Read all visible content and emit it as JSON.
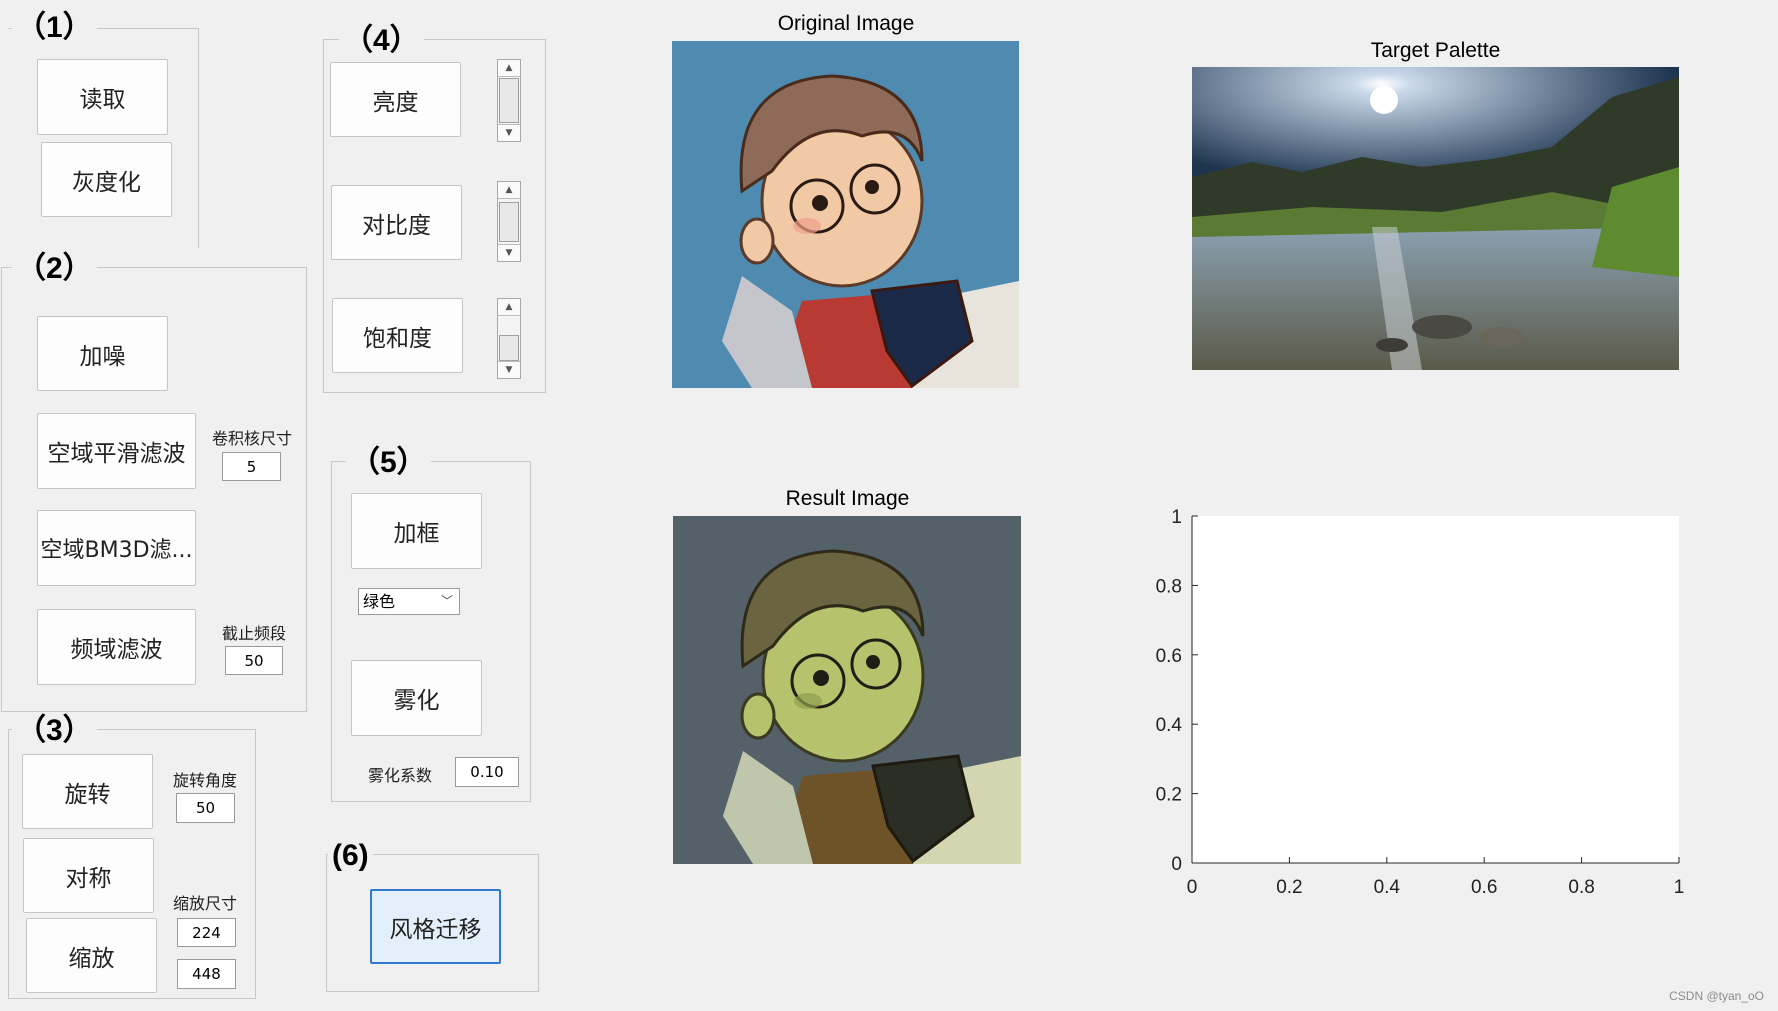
{
  "panel1": {
    "title": "（1）",
    "read_label": "读取",
    "gray_label": "灰度化"
  },
  "panel2": {
    "title": "（2）",
    "noise_label": "加噪",
    "spatial_smooth_label": "空域平滑滤波",
    "kernel_size_label": "卷积核尺寸",
    "kernel_size_value": "5",
    "bm3d_label": "空域BM3D滤...",
    "freq_filter_label": "频域滤波",
    "cutoff_label": "截止频段",
    "cutoff_value": "50"
  },
  "panel3": {
    "title": "（3）",
    "rotate_label": "旋转",
    "rotate_angle_label": "旋转角度",
    "rotate_angle_value": "50",
    "symmetry_label": "对称",
    "scale_label": "缩放",
    "scale_size_label": "缩放尺寸",
    "scale_w_value": "224",
    "scale_h_value": "448"
  },
  "panel4": {
    "title": "（4）",
    "brightness_label": "亮度",
    "contrast_label": "对比度",
    "saturation_label": "饱和度"
  },
  "panel5": {
    "title": "（5）",
    "frame_label": "加框",
    "color_select_value": "绿色",
    "fog_label": "雾化",
    "fog_coef_label": "雾化系数",
    "fog_coef_value": "0.10"
  },
  "panel6": {
    "title": "(6)",
    "style_transfer_label": "风格迁移"
  },
  "images": {
    "original_title": "Original Image",
    "target_title": "Target Palette",
    "result_title": "Result Image"
  },
  "chart_data": {
    "type": "scatter",
    "series": [],
    "xlim": [
      0,
      1
    ],
    "ylim": [
      0,
      1
    ],
    "x_ticks": [
      "0",
      "0.2",
      "0.4",
      "0.6",
      "0.8",
      "1"
    ],
    "y_ticks": [
      "0",
      "0.2",
      "0.4",
      "0.6",
      "0.8",
      "1"
    ],
    "grid": false
  },
  "watermark": "CSDN @tyan_oO",
  "colors": {
    "primary_button_bg": "#e3effa",
    "primary_button_border": "#2f7ad0"
  }
}
